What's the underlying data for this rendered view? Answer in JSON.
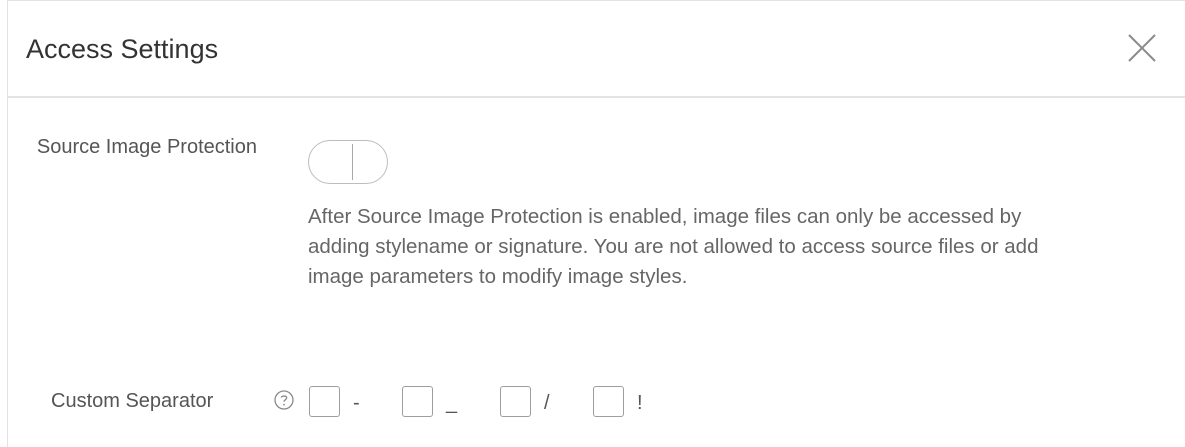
{
  "dialog": {
    "title": "Access Settings",
    "close_icon": "close-icon"
  },
  "source_image_protection": {
    "label": "Source Image Protection",
    "enabled": false,
    "description": "After Source Image Protection is enabled, image files can only be accessed by adding stylename or signature. You are not allowed to access source files or add image parameters to modify image styles."
  },
  "custom_separator": {
    "label": "Custom Separator",
    "help_icon": "help-circle-icon",
    "options": [
      {
        "char": "-",
        "checked": false
      },
      {
        "char": "_",
        "checked": false
      },
      {
        "char": "/",
        "checked": false
      },
      {
        "char": "!",
        "checked": false
      }
    ]
  }
}
